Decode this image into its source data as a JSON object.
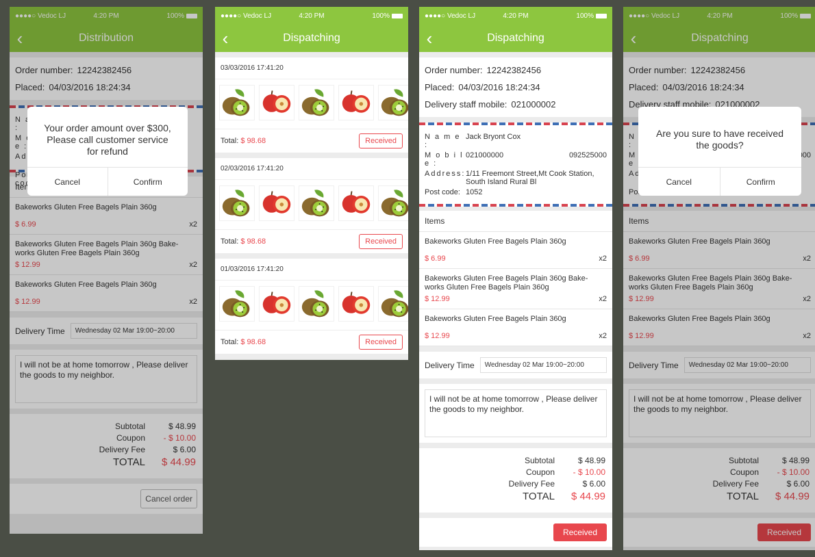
{
  "status": {
    "carrier": "●●●●○ Vedoc LJ",
    "time": "4:20 PM",
    "battery": "100%"
  },
  "colors": {
    "green": "#8dc63f",
    "red": "#e8474d"
  },
  "screens": {
    "s1": {
      "title": "Distribution"
    },
    "s2": {
      "title": "Dispatching"
    },
    "s3": {
      "title": "Dispatching"
    },
    "s4": {
      "title": "Dispatching"
    }
  },
  "order": {
    "number_label": "Order number:",
    "number": "12242382456",
    "placed_label": "Placed:",
    "placed": "04/03/2016 18:24:34",
    "mobile_label": "Delivery staff mobile:",
    "mobile": "021000002"
  },
  "address": {
    "name_label": "N a m e :",
    "name": "Jack Bryont Cox",
    "mobile_label": "M o b i l e :",
    "mobile1": "021000000",
    "mobile2": "092525000",
    "address_label": "Address:",
    "address": "1/11 Freemont Street,Mt Cook Station, South Island Rural Bl",
    "post_label": "Post code:",
    "post": "1052"
  },
  "items_label": "Items",
  "items": [
    {
      "name": "Bakeworks Gluten Free Bagels Plain 360g",
      "price": "$ 6.99",
      "qty": "x2"
    },
    {
      "name": "Bakeworks Gluten Free Bagels Plain 360g Bake-works Gluten Free Bagels Plain 360g",
      "price": "$ 12.99",
      "qty": "x2"
    },
    {
      "name": "Bakeworks Gluten Free Bagels Plain 360g",
      "price": "$ 12.99",
      "qty": "x2"
    }
  ],
  "delivery": {
    "label": "Delivery Time",
    "value": "Wednesday 02 Mar  19:00~20:00"
  },
  "note": "I will not be at home tomorrow , Please deliver the goods to my neighbor.",
  "totals": {
    "subtotal_label": "Subtotal",
    "subtotal": "$ 48.99",
    "coupon_label": "Coupon",
    "coupon": "- $ 10.00",
    "fee_label": "Delivery Fee",
    "fee": "$ 6.00",
    "total_label": "TOTAL",
    "total": "$ 44.99"
  },
  "buttons": {
    "cancel_order": "Cancel order",
    "received": "Received"
  },
  "dialog1": {
    "message": "Your order amount over $300, Please call customer service for refund",
    "cancel": "Cancel",
    "confirm": "Confirm"
  },
  "dialog2": {
    "message": "Are you sure to have received the goods?",
    "cancel": "Cancel",
    "confirm": "Confirm"
  },
  "dispatch_orders": [
    {
      "date": "03/03/2016  17:41:20",
      "total_label": "Total:",
      "total": "$ 98.68",
      "button": "Received"
    },
    {
      "date": "02/03/2016  17:41:20",
      "total_label": "Total:",
      "total": "$ 98.68",
      "button": "Received"
    },
    {
      "date": "01/03/2016  17:41:20",
      "total_label": "Total:",
      "total": "$ 98.68",
      "button": "Received"
    }
  ],
  "fruit_icons": [
    "kiwi-icon",
    "apple-icon",
    "kiwi-icon",
    "apple-icon",
    "kiwi-icon"
  ]
}
